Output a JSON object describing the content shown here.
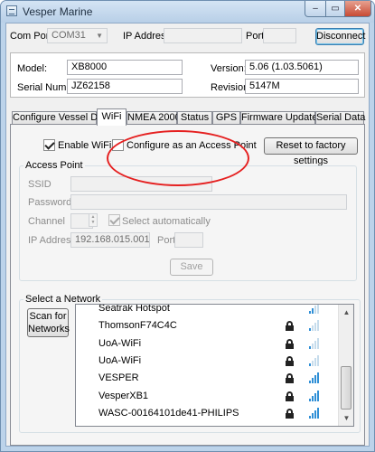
{
  "window": {
    "title": "Vesper Marine",
    "close_glyph": "✕",
    "min_glyph": "–",
    "max_glyph": "▭"
  },
  "connection": {
    "com_port_label": "Com Port:",
    "com_port_value": "COM31",
    "ip_label": "IP Address:",
    "ip_value": "",
    "port_label": "Port:",
    "port_value": "",
    "disconnect_label": "Disconnect"
  },
  "device": {
    "model_label": "Model:",
    "model_value": "XB8000",
    "version_label": "Version:",
    "version_value": "5.06 (1.03.5061)",
    "serial_label": "Serial Number:",
    "serial_value": "JZ62158",
    "revision_label": "Revision:",
    "revision_value": "5147M"
  },
  "tabs": [
    {
      "label": "Configure Vessel Data",
      "active": false
    },
    {
      "label": "WiFi",
      "active": true
    },
    {
      "label": "NMEA 2000",
      "active": false
    },
    {
      "label": "Status",
      "active": false
    },
    {
      "label": "GPS",
      "active": false
    },
    {
      "label": "Firmware Update",
      "active": false
    },
    {
      "label": "Serial Data",
      "active": false
    }
  ],
  "wifi": {
    "enable_label": "Enable WiFi",
    "enable_checked": true,
    "access_point_toggle_label": "Configure as an Access Point",
    "access_point_checked": false,
    "reset_label": "Reset to factory settings"
  },
  "access_point": {
    "group_title": "Access Point",
    "ssid_label": "SSID",
    "ssid_value": "",
    "password_label": "Password",
    "password_value": "",
    "channel_label": "Channel",
    "channel_value": "",
    "select_auto_label": "Select automatically",
    "select_auto_checked": true,
    "ip_label": "IP Address",
    "ip_value": "192.168.015.001",
    "port_label": "Port",
    "port_value": "",
    "save_label": "Save"
  },
  "networks": {
    "group_title": "Select a Network",
    "scan_label_line1": "Scan for",
    "scan_label_line2": "Networks",
    "items": [
      {
        "name": "Seatrak Hotspot",
        "locked": false,
        "signal": 2
      },
      {
        "name": "ThomsonF74C4C",
        "locked": true,
        "signal": 1
      },
      {
        "name": "UoA-WiFi",
        "locked": true,
        "signal": 1
      },
      {
        "name": "UoA-WiFi",
        "locked": true,
        "signal": 1
      },
      {
        "name": "VESPER",
        "locked": true,
        "signal": 4
      },
      {
        "name": "VesperXB1",
        "locked": true,
        "signal": 4
      },
      {
        "name": "WASC-00164101de41-PHILIPS",
        "locked": true,
        "signal": 4
      }
    ]
  },
  "colors": {
    "signal_on": "#2f8fd6",
    "signal_off": "#c6dcec",
    "annotation_circle": "#e52020"
  }
}
